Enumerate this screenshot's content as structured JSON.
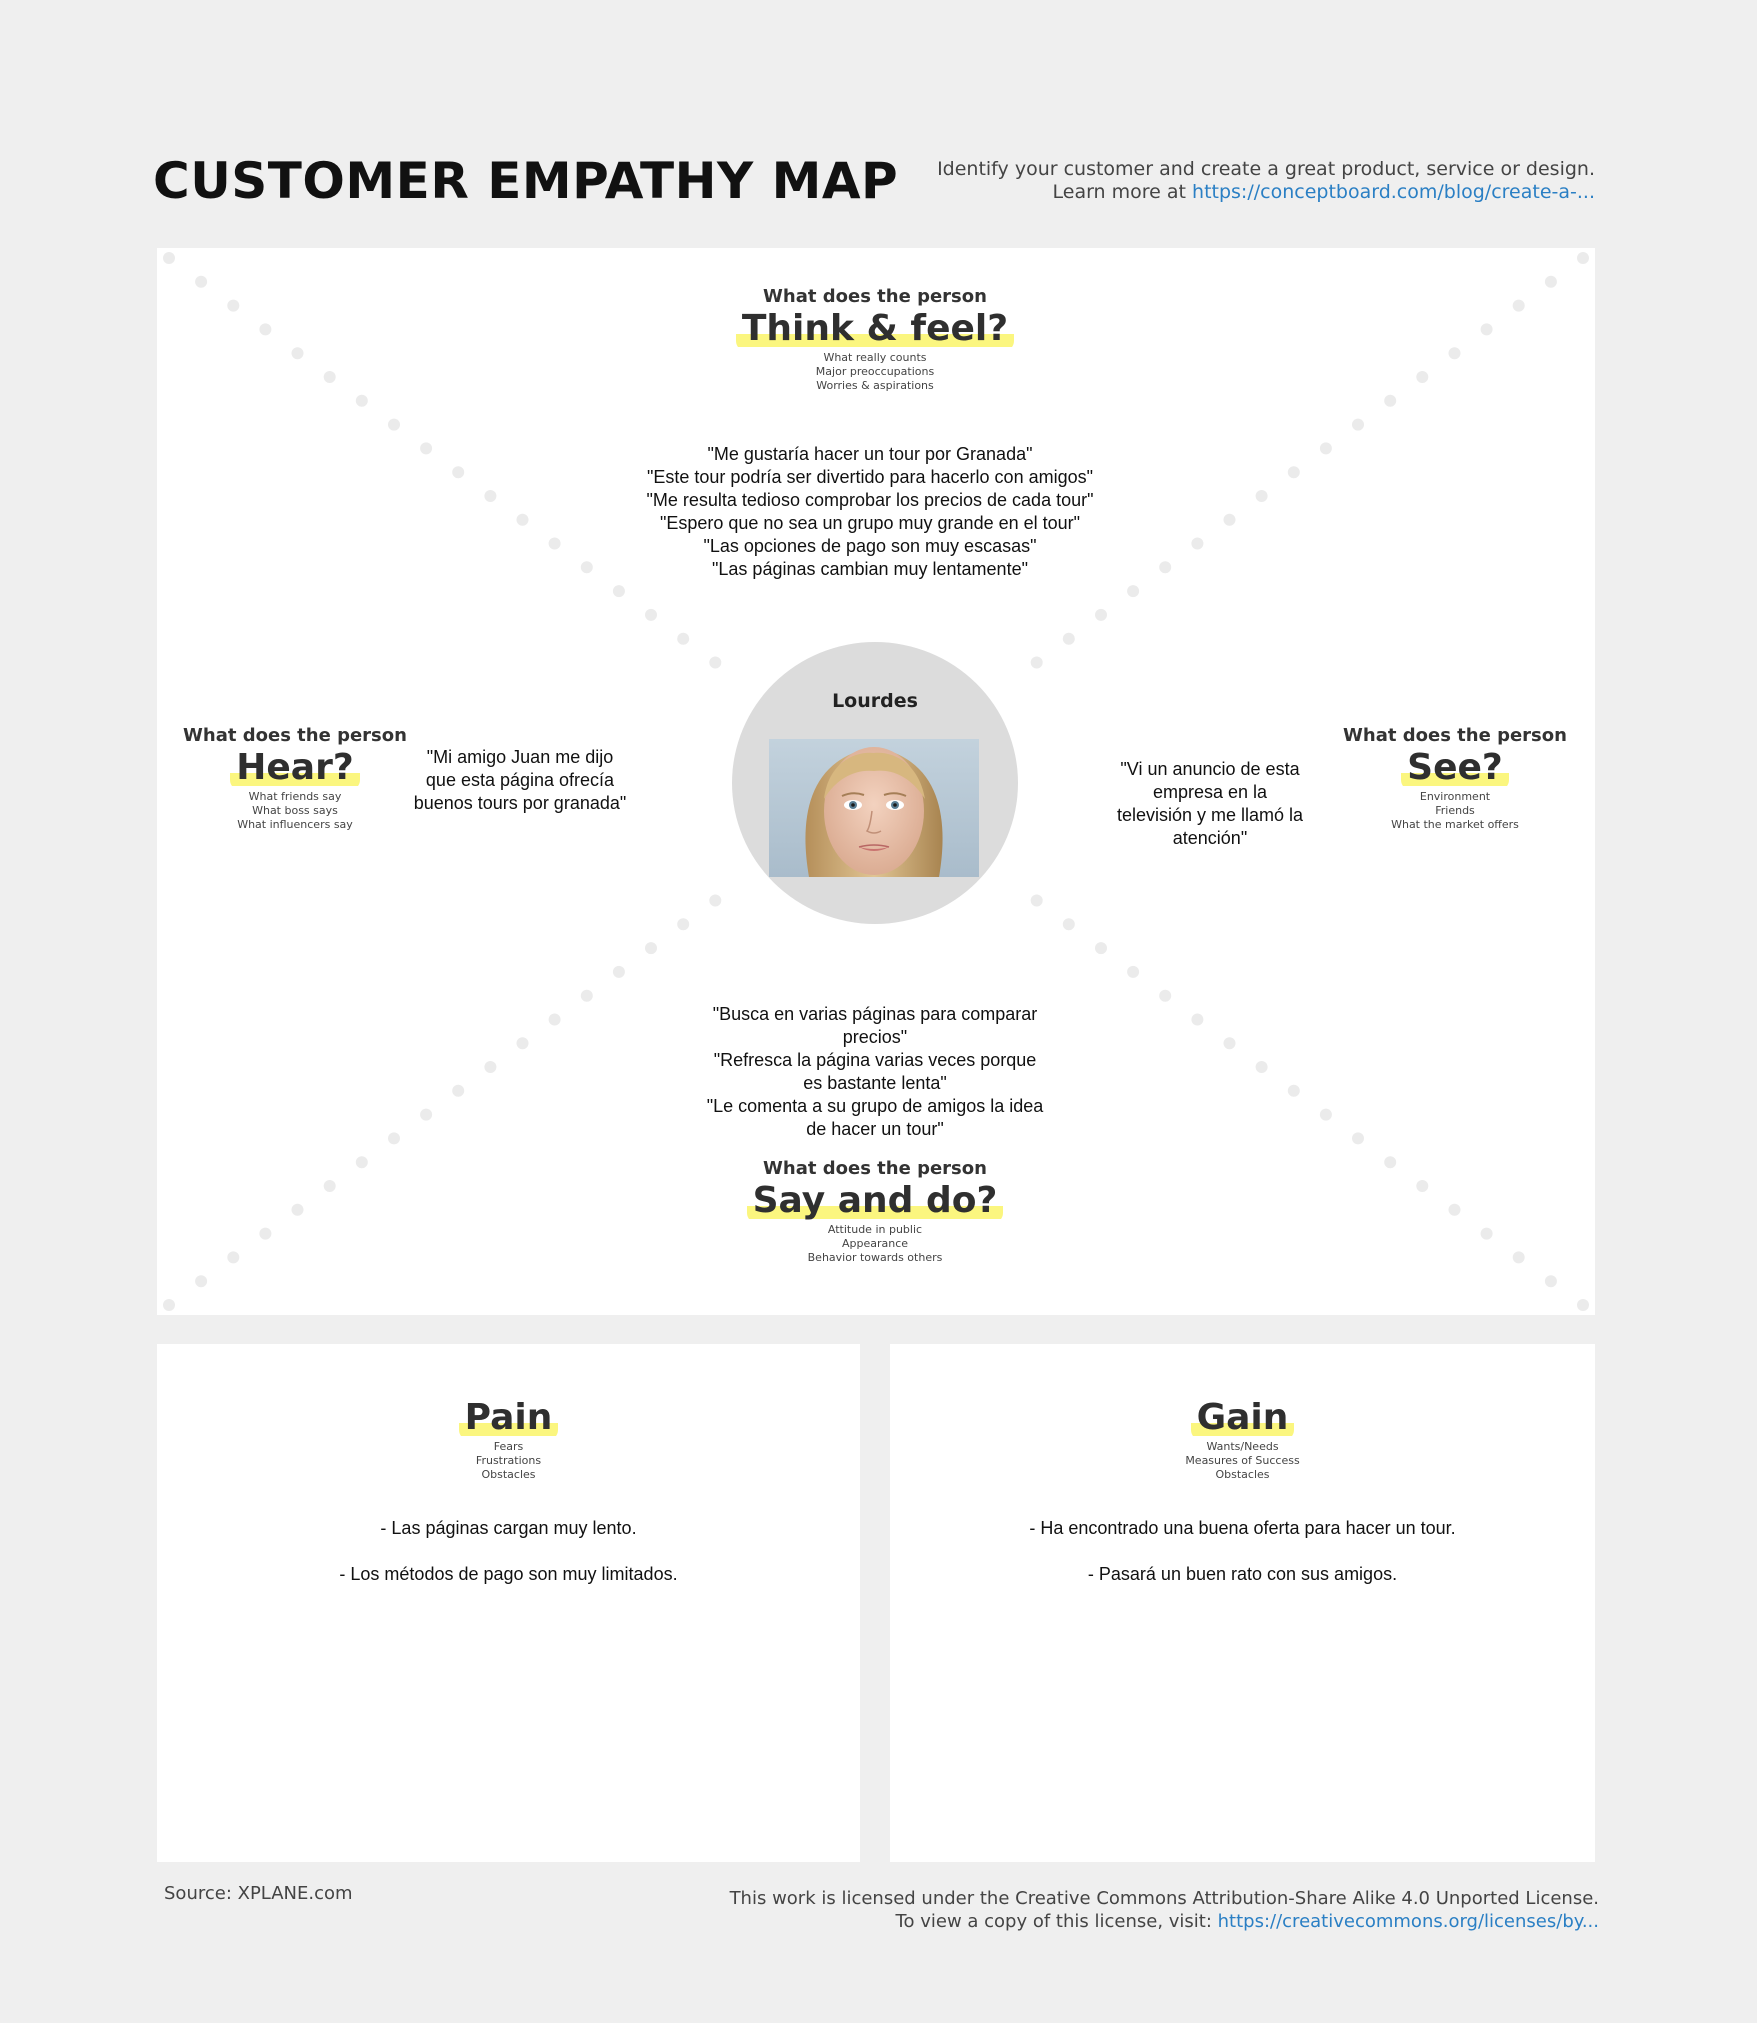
{
  "header": {
    "title": "CUSTOMER EMPATHY MAP",
    "intro_line1": "Identify your customer and create a great product, service or design.",
    "intro_line2_prefix": "Learn more at ",
    "intro_link": "https://conceptboard.com/blog/create-a-..."
  },
  "persona": {
    "name": "Lourdes"
  },
  "think_feel": {
    "question": "What does the person",
    "title": "Think & feel?",
    "hints": [
      "What really counts",
      "Major preoccupations",
      "Worries & aspirations"
    ],
    "notes": [
      "\"Me gustaría hacer un tour por Granada\"",
      "\"Este tour podría ser divertido para hacerlo con amigos\"",
      "\"Me resulta tedioso comprobar los precios de cada tour\"",
      "\"Espero que no sea un grupo muy grande en el tour\"",
      "\"Las opciones de pago son muy escasas\"",
      "\"Las páginas cambian muy lentamente\""
    ]
  },
  "hear": {
    "question": "What does the person",
    "title": "Hear?",
    "hints": [
      "What friends say",
      "What boss says",
      "What influencers say"
    ],
    "notes": [
      "\"Mi amigo Juan me dijo",
      "que esta página ofrecía",
      "buenos tours por granada\""
    ]
  },
  "see": {
    "question": "What does the person",
    "title": "See?",
    "hints": [
      "Environment",
      "Friends",
      "What the market offers"
    ],
    "notes": [
      "\"Vi un anuncio de esta",
      "empresa en la",
      "televisión y me llamó la",
      "atención\""
    ]
  },
  "say_do": {
    "question": "What does the person",
    "title": "Say and do?",
    "hints": [
      "Attitude in public",
      "Appearance",
      "Behavior towards others"
    ],
    "notes": [
      "\"Busca en varias páginas para comparar",
      "precios\"",
      "\"Refresca la página varias veces porque",
      "es bastante lenta\"",
      "\"Le comenta a su grupo de amigos la idea",
      "de hacer un tour\""
    ]
  },
  "pain": {
    "title": "Pain",
    "hints": [
      "Fears",
      "Frustrations",
      "Obstacles"
    ],
    "notes": [
      "- Las páginas cargan muy lento.",
      "- Los métodos de pago son muy limitados."
    ]
  },
  "gain": {
    "title": "Gain",
    "hints": [
      "Wants/Needs",
      "Measures of Success",
      "Obstacles"
    ],
    "notes": [
      "- Ha encontrado una buena oferta para hacer un tour.",
      "- Pasará un buen rato con sus amigos."
    ]
  },
  "footer": {
    "source": "Source: XPLANE.com",
    "license_line1": "This work is licensed under the Creative Commons Attribution-Share Alike 4.0 Unported License.",
    "license_line2_prefix": "To view a copy of this license, visit: ",
    "license_link": "https://creativecommons.org/licenses/by..."
  },
  "colors": {
    "background": "#efefef",
    "panel": "#ffffff",
    "highlight": "#fbf67f",
    "link": "#2a7fc4",
    "dots": "#ebebeb",
    "avatar_circle": "#dcdcdc"
  }
}
